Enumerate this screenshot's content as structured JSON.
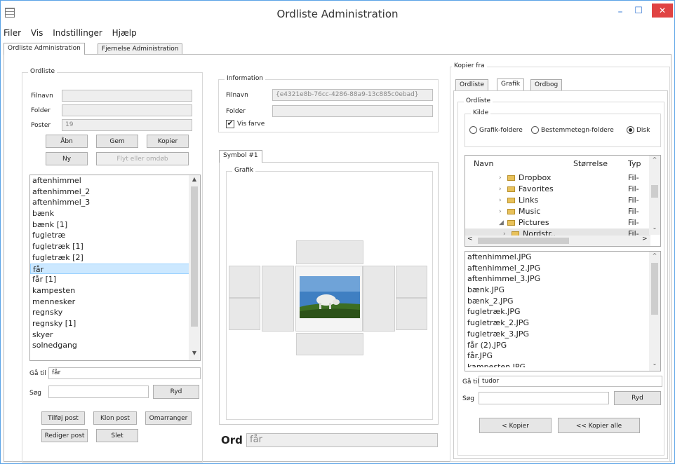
{
  "window": {
    "title": "Ordliste Administration",
    "minimize": "–",
    "maximize": "☐",
    "close": "✕",
    "app_icon": "grid-icon"
  },
  "menu": [
    "Filer",
    "Vis",
    "Indstillinger",
    "Hjælp"
  ],
  "main_tabs": [
    "Ordliste Administration",
    "Fjernelse Administration"
  ],
  "left": {
    "group": "Ordliste",
    "filnavn_label": "Filnavn",
    "filnavn_value": "",
    "folder_label": "Folder",
    "folder_value": "",
    "poster_label": "Poster",
    "poster_value": "19",
    "btn_open": "Åbn",
    "btn_save": "Gem",
    "btn_copy": "Kopier",
    "btn_new": "Ny",
    "btn_move": "Flyt eller omdøb",
    "items": [
      "aftenhimmel",
      "aftenhimmel_2",
      "aftenhimmel_3",
      "bænk",
      "bænk [1]",
      "fugletræ",
      "fugletræk [1]",
      "fugletræk [2]",
      "får",
      "får [1]",
      "kampesten",
      "mennesker",
      "regnsky",
      "regnsky [1]",
      "skyer",
      "solnedgang"
    ],
    "selected_index": 8,
    "goto_label": "Gå til",
    "goto_value": "får",
    "search_label": "Søg",
    "search_value": "",
    "clear_btn": "Ryd",
    "btn_add": "Tilføj post",
    "btn_clone": "Klon post",
    "btn_reorder": "Omarranger",
    "btn_edit": "Rediger post",
    "btn_delete": "Slet"
  },
  "middle": {
    "info_group": "Information",
    "filnavn_label": "Filnavn",
    "filnavn_value": "{e4321e8b-76cc-4286-88a9-13c885c0ebad}",
    "folder_label": "Folder",
    "folder_value": "",
    "show_color_label": "Vis farve",
    "show_color_checked": true,
    "symbol_tab": "Symbol #1",
    "graphic_group": "Grafik",
    "word_label": "Ord",
    "word_value": "får"
  },
  "right": {
    "group": "Kopier fra",
    "tabs": [
      "Ordliste",
      "Grafik",
      "Ordbog"
    ],
    "inner_group": "Ordliste",
    "source_group": "Kilde",
    "radio": [
      "Grafik-foldere",
      "Bestemmetegn-foldere",
      "Disk"
    ],
    "radio_selected": 2,
    "tree_headers": [
      "Navn",
      "Størrelse",
      "Typ"
    ],
    "tree": [
      {
        "name": "Dropbox",
        "type": "Fil-",
        "icon": "folder-icon",
        "expander": "›"
      },
      {
        "name": "Favorites",
        "type": "Fil-",
        "icon": "folder-icon",
        "expander": "›"
      },
      {
        "name": "Links",
        "type": "Fil-",
        "icon": "folder-icon",
        "expander": "›"
      },
      {
        "name": "Music",
        "type": "Fil-",
        "icon": "folder-icon",
        "expander": "›"
      },
      {
        "name": "Pictures",
        "type": "Fil-",
        "icon": "folder-icon",
        "expander": "◢"
      },
      {
        "name": "Nordstr..",
        "type": "Fil-",
        "icon": "folder-icon",
        "expander": "›"
      }
    ],
    "files": [
      "aftenhimmel.JPG",
      "aftenhimmel_2.JPG",
      "aftenhimmel_3.JPG",
      "bænk.JPG",
      "bænk_2.JPG",
      "fugletræk.JPG",
      "fugletræk_2.JPG",
      "fugletræk_3.JPG",
      "får (2).JPG",
      "får.JPG",
      "kampesten.JPG"
    ],
    "goto_label": "Gå til",
    "goto_value": "tudor",
    "search_label": "Søg",
    "search_value": "",
    "clear_btn": "Ryd",
    "btn_copy": "< Kopier",
    "btn_copy_all": "<< Kopier alle"
  }
}
